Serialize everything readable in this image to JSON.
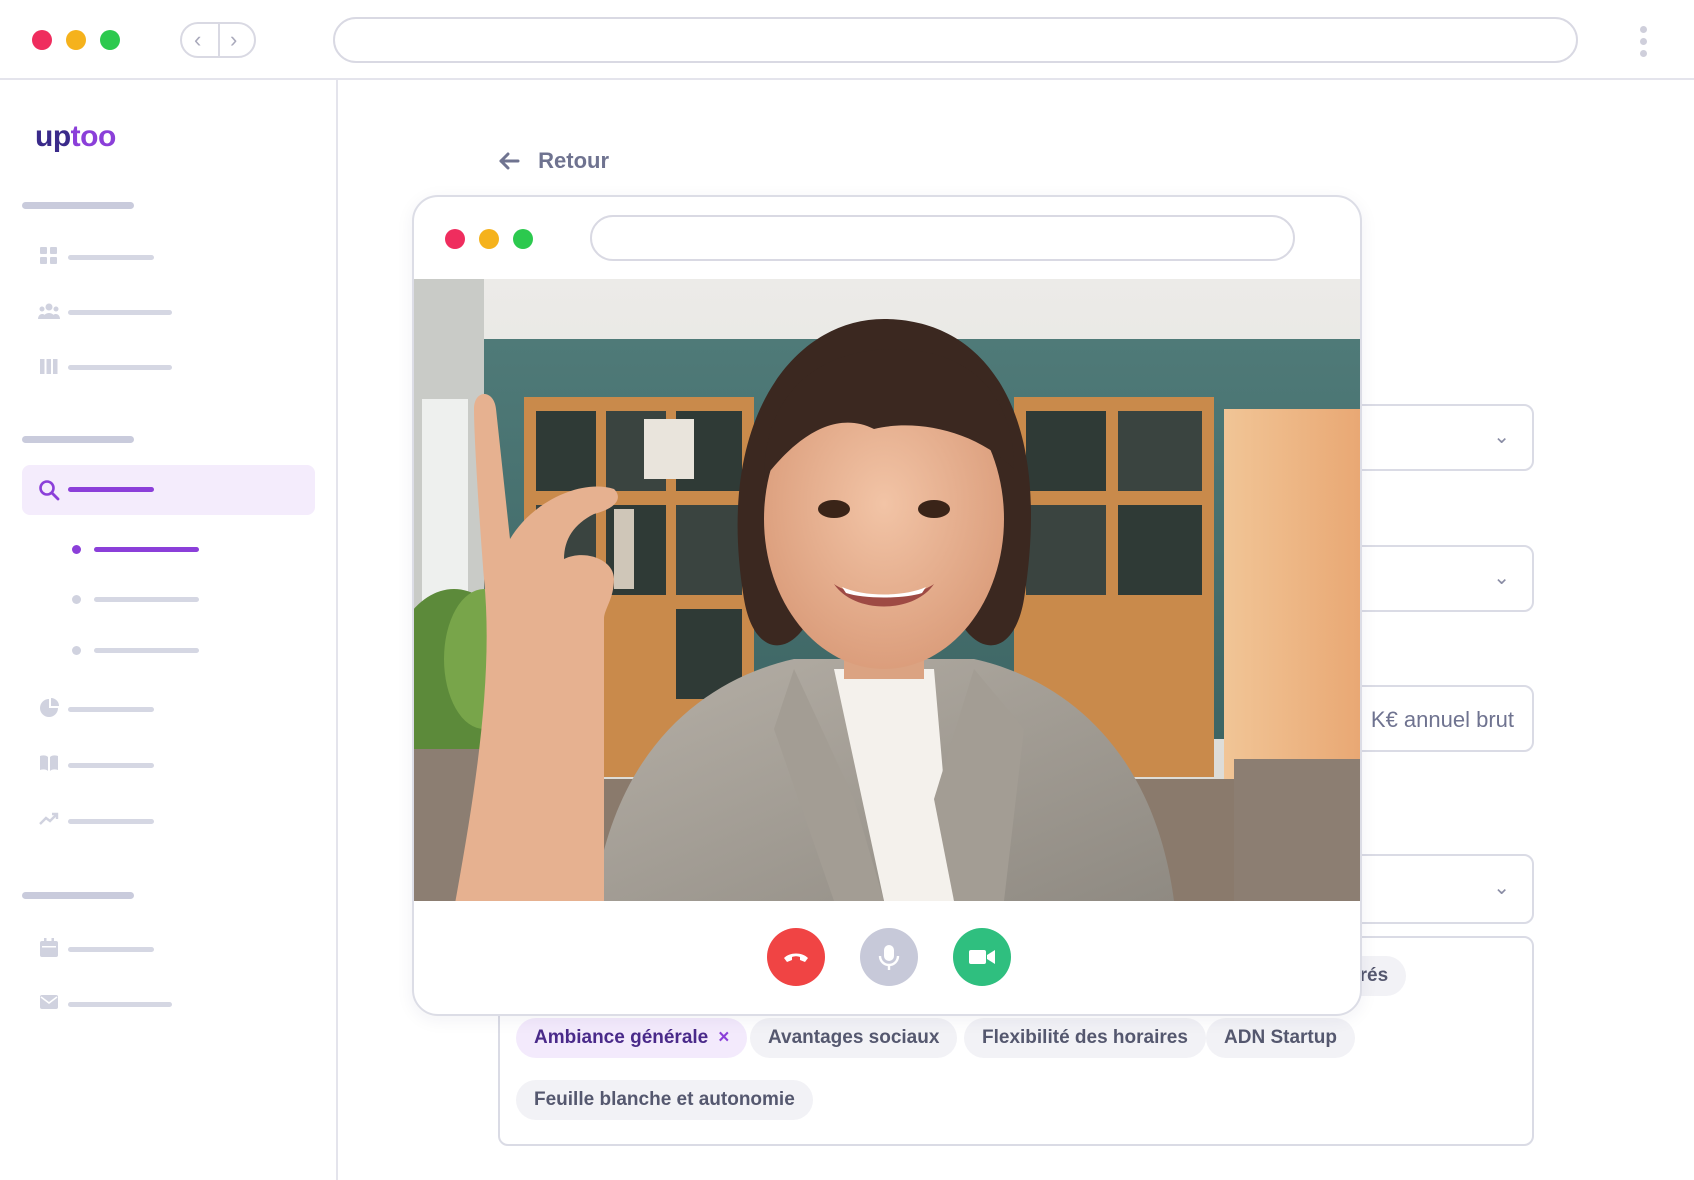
{
  "browser": {
    "traffic_lights": [
      "#ef2d5e",
      "#f5b21c",
      "#2cc94e"
    ],
    "back_glyph": "‹",
    "forward_glyph": "›"
  },
  "sidebar": {
    "logo": {
      "part1": "up",
      "part2": "too"
    },
    "active_color": "#8b3fd9"
  },
  "main": {
    "back_label": "Retour",
    "salary_suffix": "K€ annuel brut",
    "partial_tag": "urés",
    "tags": [
      {
        "label": "Ambiance générale",
        "selected": true,
        "remove": "×"
      },
      {
        "label": "Avantages sociaux",
        "selected": false
      },
      {
        "label": "Flexibilité des horaires",
        "selected": false
      },
      {
        "label": "ADN Startup",
        "selected": false
      },
      {
        "label": "Feuille blanche et autonomie",
        "selected": false
      }
    ]
  },
  "video_call": {
    "controls": {
      "hangup_color": "#f04444",
      "mic_color": "#c7c9d9",
      "camera_color": "#2fbf7f"
    }
  }
}
